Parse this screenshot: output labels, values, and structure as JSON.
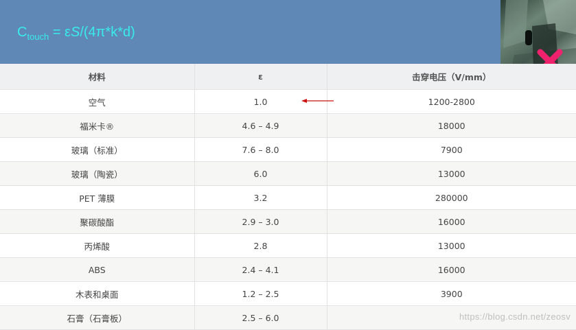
{
  "header": {
    "formula": {
      "c": "C",
      "subscript": "touch",
      "eq": " = ε",
      "s": "S",
      "rest": "/(4π*k*d)"
    }
  },
  "table": {
    "headers": [
      "材料",
      "ε",
      "击穿电压（V/mm）"
    ],
    "rows": [
      [
        "空气",
        "1.0",
        "1200-2800"
      ],
      [
        "福米卡®",
        "4.6 – 4.9",
        "18000"
      ],
      [
        "玻璃（标准）",
        "7.6 – 8.0",
        "7900"
      ],
      [
        "玻璃（陶瓷）",
        "6.0",
        "13000"
      ],
      [
        "PET 薄膜",
        "3.2",
        "280000"
      ],
      [
        "聚碳酸酯",
        "2.9 – 3.0",
        "16000"
      ],
      [
        "丙烯酸",
        "2.8",
        "13000"
      ],
      [
        "ABS",
        "2.4 – 4.1",
        "16000"
      ],
      [
        "木表和桌面",
        "1.2 – 2.5",
        "3900"
      ],
      [
        "石膏（石膏板）",
        "2.5 – 6.0",
        ""
      ]
    ]
  },
  "watermark": "https://blog.csdn.net/zeosv",
  "colors": {
    "banner": "#5f88b6",
    "formula": "#38ecec",
    "arrow": "#cc1111",
    "close_mark": "#f0226e"
  }
}
